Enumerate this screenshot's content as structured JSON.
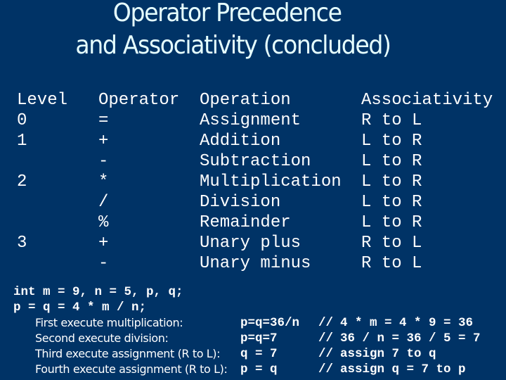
{
  "slide": {
    "title_line1": "Operator Precedence",
    "title_line2": "and Associativity (concluded)",
    "colors": {
      "background": "#003366",
      "title": "#e6ffff",
      "text": "#ffffff"
    }
  },
  "table": {
    "headers": {
      "level": "Level",
      "operator": "Operator",
      "operation": "Operation",
      "associativity": "Associativity"
    },
    "rows": [
      {
        "level": "0",
        "operator": "=",
        "operation": "Assignment",
        "associativity": "R to L"
      },
      {
        "level": "1",
        "operator": "+",
        "operation": "Addition",
        "associativity": "L to R"
      },
      {
        "level": "",
        "operator": "-",
        "operation": "Subtraction",
        "associativity": "L to R"
      },
      {
        "level": "2",
        "operator": "*",
        "operation": "Multiplication",
        "associativity": "L to R"
      },
      {
        "level": "",
        "operator": "/",
        "operation": "Division",
        "associativity": "L to R"
      },
      {
        "level": "",
        "operator": "%",
        "operation": "Remainder",
        "associativity": "L to R"
      },
      {
        "level": "3",
        "operator": "+",
        "operation": "Unary plus",
        "associativity": "R to L"
      },
      {
        "level": "",
        "operator": "-",
        "operation": "Unary minus",
        "associativity": "R to L"
      }
    ]
  },
  "code": {
    "declaration": "int m = 9, n = 5, p, q;",
    "statement": "p = q = 4 * m / n;",
    "comment_marker": "//",
    "steps": [
      {
        "label": "First execute multiplication:",
        "expr": "p=q=36/n",
        "comment": "4 * m = 4 * 9 = 36"
      },
      {
        "label": "Second execute division:",
        "expr": "p=q=7",
        "comment": "36 / n = 36 / 5 = 7"
      },
      {
        "label": "Third execute assignment (R to L):",
        "expr": "q = 7",
        "comment": "assign 7 to q"
      },
      {
        "label": "Fourth execute assignment (R to L):",
        "expr": "p = q",
        "comment": "assign q = 7 to p"
      }
    ]
  }
}
